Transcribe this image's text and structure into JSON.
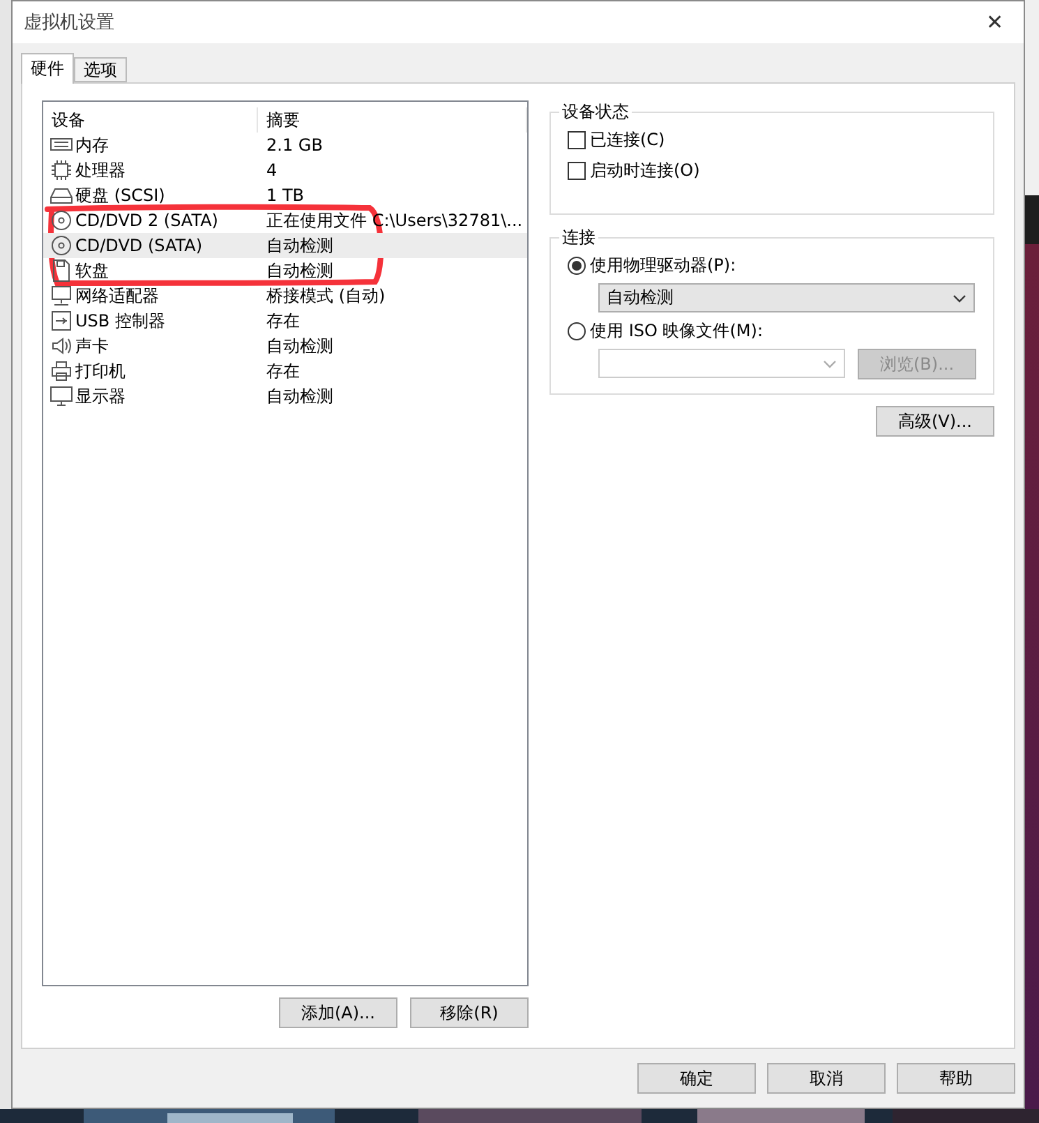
{
  "window": {
    "title": "虚拟机设置",
    "close": "✕"
  },
  "tabs": [
    {
      "label": "硬件",
      "selected": true
    },
    {
      "label": "选项",
      "selected": false
    }
  ],
  "device_table": {
    "columns": [
      "设备",
      "摘要"
    ],
    "rows": [
      {
        "kind": "memory",
        "device": "内存",
        "summary": "2.1 GB",
        "selected": false
      },
      {
        "kind": "cpu",
        "device": "处理器",
        "summary": "4",
        "selected": false
      },
      {
        "kind": "disk",
        "device": "硬盘 (SCSI)",
        "summary": "1 TB",
        "selected": false
      },
      {
        "kind": "cdrom",
        "device": "CD/DVD 2 (SATA)",
        "summary": "正在使用文件 C:\\Users\\32781\\...",
        "selected": false
      },
      {
        "kind": "cdrom",
        "device": "CD/DVD (SATA)",
        "summary": "自动检测",
        "selected": true
      },
      {
        "kind": "floppy",
        "device": "软盘",
        "summary": "自动检测",
        "selected": false
      },
      {
        "kind": "network",
        "device": "网络适配器",
        "summary": "桥接模式 (自动)",
        "selected": false
      },
      {
        "kind": "usb",
        "device": "USB 控制器",
        "summary": "存在",
        "selected": false
      },
      {
        "kind": "sound",
        "device": "声卡",
        "summary": "自动检测",
        "selected": false
      },
      {
        "kind": "printer",
        "device": "打印机",
        "summary": "存在",
        "selected": false
      },
      {
        "kind": "display",
        "device": "显示器",
        "summary": "自动检测",
        "selected": false
      }
    ]
  },
  "list_buttons": [
    "添加(A)...",
    "移除(R)"
  ],
  "device_status": {
    "title": "设备状态",
    "options": [
      {
        "label": "已连接(C)",
        "checked": false
      },
      {
        "label": "启动时连接(O)",
        "checked": false
      }
    ]
  },
  "connection": {
    "title": "连接",
    "options": [
      {
        "label": "使用物理驱动器(P):",
        "selected": true,
        "dropdown": {
          "value": "自动检测",
          "disabled": false
        }
      },
      {
        "label": "使用 ISO 映像文件(M):",
        "selected": false,
        "dropdown": {
          "disabled": true
        },
        "button": {
          "label": "浏览(B)...",
          "disabled": true
        }
      }
    ]
  },
  "advanced_button": "高级(V)...",
  "dialog_buttons": [
    "确定",
    "取消",
    "帮助"
  ]
}
